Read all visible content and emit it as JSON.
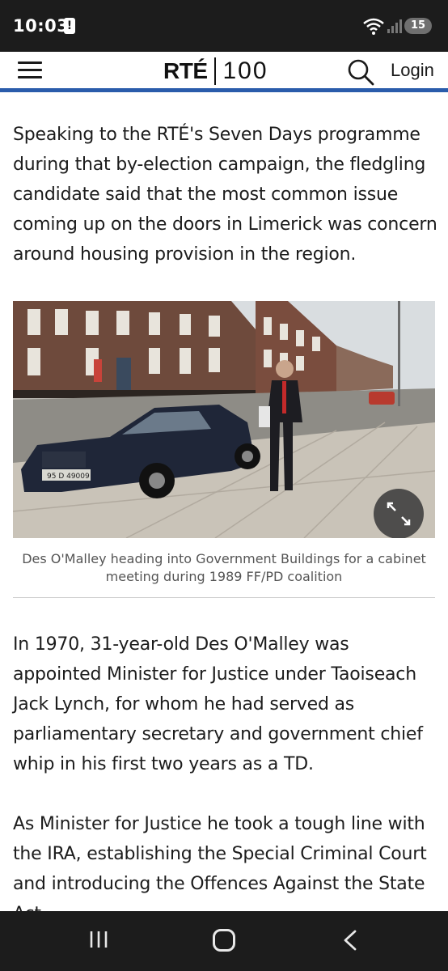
{
  "status_bar": {
    "time": "10:03",
    "battery": "15"
  },
  "header": {
    "logo_brand": "RTÉ",
    "logo_suffix": "100",
    "login_label": "Login",
    "accent_color": "#2a5cab"
  },
  "article": {
    "paragraphs": [
      "Speaking to the RTÉ's Seven Days programme during that by-election campaign, the fledgling candidate said that the most common issue coming up on the doors in Limerick was concern around housing provision in the region.",
      "In 1970, 31-year-old Des O'Malley was appointed Minister for Justice under Taoiseach Jack Lynch, for whom he had served as parliamentary secretary and government chief whip in his first two years as a TD.",
      "As Minister for Justice he took a tough line with the IRA, establishing the Special Criminal Court and introducing the Offences Against the State Act."
    ],
    "image": {
      "car_plate": "95 D 49009",
      "caption": "Des O'Malley heading into Government Buildings for a cabinet meeting during 1989 FF/PD coalition"
    }
  },
  "icons": {
    "menu": "menu-icon",
    "search": "search-icon",
    "expand": "expand-icon",
    "recents": "recents-icon",
    "home": "home-icon",
    "back": "back-icon"
  }
}
